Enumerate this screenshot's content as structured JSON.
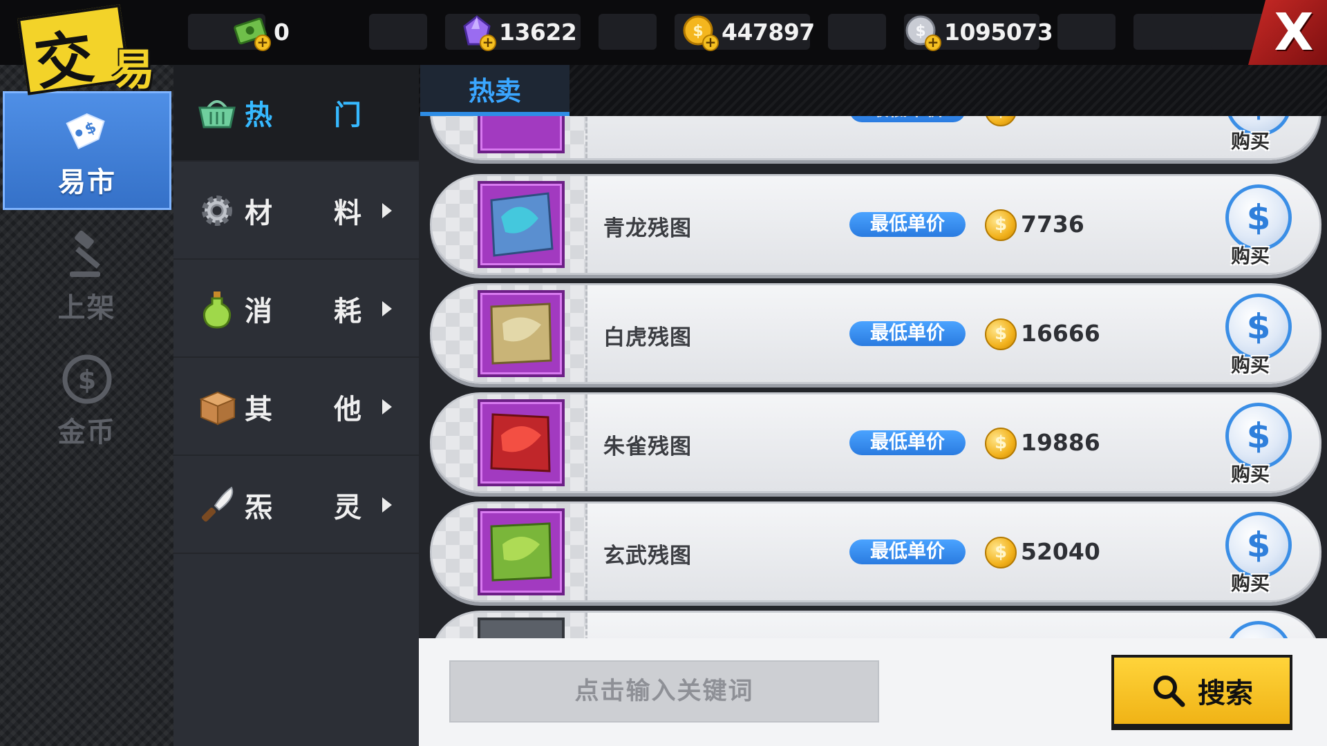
{
  "title_badge": {
    "char1": "交",
    "char2": "易"
  },
  "currencies": [
    {
      "name": "cash-icon",
      "value": "0"
    },
    {
      "name": "gem-icon",
      "value": "13622"
    },
    {
      "name": "gold-coin-icon",
      "value": "447897"
    },
    {
      "name": "silver-coin-icon",
      "value": "1095073"
    }
  ],
  "close_label": "X",
  "left_nav": [
    {
      "label": "易市",
      "icon": "price-tag-icon",
      "active": true
    },
    {
      "label": "上架",
      "icon": "gavel-icon",
      "active": false
    },
    {
      "label": "金币",
      "icon": "coin-icon",
      "active": false
    }
  ],
  "categories": [
    {
      "c1": "热",
      "c2": "门",
      "icon": "basket-icon",
      "active": true,
      "arrow": false
    },
    {
      "c1": "材",
      "c2": "料",
      "icon": "gear-icon",
      "active": false,
      "arrow": true
    },
    {
      "c1": "消",
      "c2": "耗",
      "icon": "potion-icon",
      "active": false,
      "arrow": true
    },
    {
      "c1": "其",
      "c2": "他",
      "icon": "box-icon",
      "active": false,
      "arrow": true
    },
    {
      "c1": "炁",
      "c2": "灵",
      "icon": "knife-icon",
      "active": false,
      "arrow": true
    }
  ],
  "tabs": [
    {
      "label": "热卖",
      "active": true
    }
  ],
  "items": [
    {
      "name": "青龙残图",
      "price_label": "最低单价",
      "price": "7736",
      "buy_label": "购买",
      "buy_symbol": "$",
      "coin_symbol": "$"
    },
    {
      "name": "白虎残图",
      "price_label": "最低单价",
      "price": "16666",
      "buy_label": "购买",
      "buy_symbol": "$",
      "coin_symbol": "$"
    },
    {
      "name": "朱雀残图",
      "price_label": "最低单价",
      "price": "19886",
      "buy_label": "购买",
      "buy_symbol": "$",
      "coin_symbol": "$"
    },
    {
      "name": "玄武残图",
      "price_label": "最低单价",
      "price": "52040",
      "buy_label": "购买",
      "buy_symbol": "$",
      "coin_symbol": "$"
    }
  ],
  "partial_top_item": {
    "name": "",
    "price_label": "最低单价",
    "buy_label": "购买"
  },
  "search": {
    "placeholder": "点击输入关键词",
    "button_label": "搜索"
  },
  "colors": {
    "accent_blue": "#2e8de6",
    "gold": "#f3d329",
    "close_red": "#c92a26",
    "item_frame_purple": "#a23ac0"
  }
}
